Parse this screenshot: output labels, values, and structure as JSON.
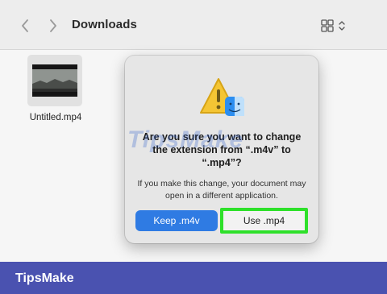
{
  "window": {
    "folder_title": "Downloads",
    "nav": {
      "back_icon": "chevron-left-icon",
      "forward_icon": "chevron-right-icon"
    },
    "view_icon": "grid-view-icon"
  },
  "files": [
    {
      "name": "Untitled.mp4",
      "icon": "video-thumbnail"
    }
  ],
  "dialog": {
    "icon": "warning-finder-icon",
    "title": "Are you sure you want to change the extension from “.m4v” to “.mp4”?",
    "message": "If you make this change, your document may open in a different application.",
    "buttons": {
      "keep_label": "Keep .m4v",
      "use_label": "Use .mp4"
    },
    "colors": {
      "primary": "#2f7be3",
      "highlight": "#2ee02a"
    }
  },
  "watermark": "TipsMake",
  "footer": {
    "brand": "TipsMake"
  }
}
